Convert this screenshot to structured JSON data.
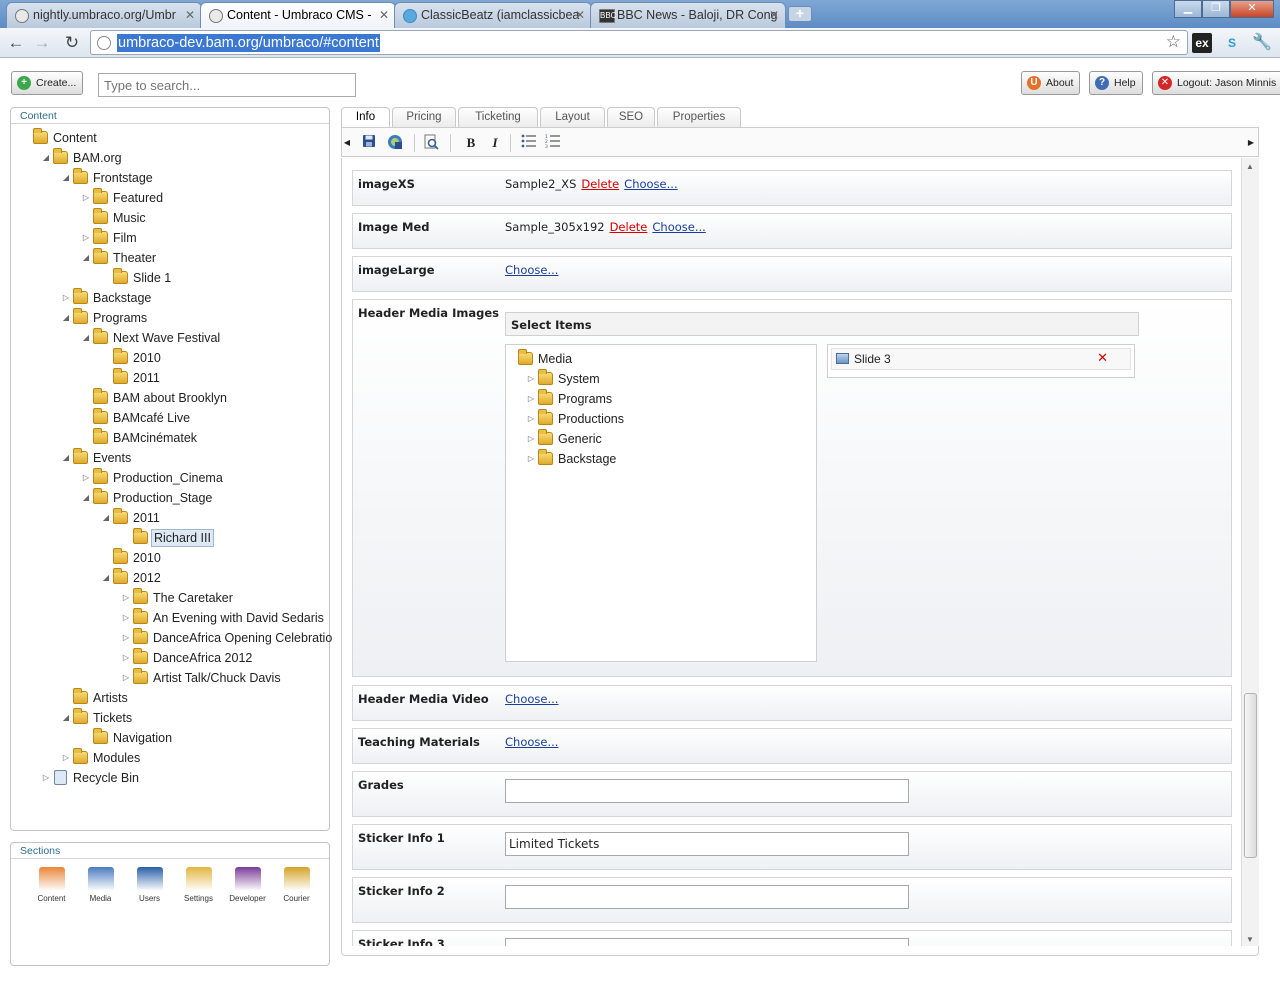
{
  "browser": {
    "tabs": [
      {
        "title": "nightly.umbraco.org/Umbr",
        "active": false,
        "favicon": "globe-icon"
      },
      {
        "title": "Content - Umbraco CMS - ",
        "active": true,
        "favicon": "globe-icon"
      },
      {
        "title": "ClassicBeatz (iamclassicbea",
        "active": false,
        "favicon": "twitter-icon"
      },
      {
        "title": "BBC News - Baloji, DR Cong",
        "active": false,
        "favicon": "bbc-icon"
      }
    ],
    "url": "umbraco-dev.bam.org/umbraco/#content",
    "ext_label": "ex"
  },
  "topbar": {
    "create_label": "Create...",
    "search_placeholder": "Type to search...",
    "about_label": "About",
    "help_label": "Help",
    "logout_label": "Logout: Jason Minnis"
  },
  "content_panel": {
    "header": "Content",
    "tree": [
      {
        "label": "Content",
        "depth": 0,
        "arrow": ""
      },
      {
        "label": "BAM.org",
        "depth": 1,
        "arrow": "open"
      },
      {
        "label": "Frontstage",
        "depth": 2,
        "arrow": "open"
      },
      {
        "label": "Featured",
        "depth": 3,
        "arrow": "closed"
      },
      {
        "label": "Music",
        "depth": 3,
        "arrow": ""
      },
      {
        "label": "Film",
        "depth": 3,
        "arrow": "closed"
      },
      {
        "label": "Theater",
        "depth": 3,
        "arrow": "open"
      },
      {
        "label": "Slide 1",
        "depth": 4,
        "arrow": ""
      },
      {
        "label": "Backstage",
        "depth": 2,
        "arrow": "closed"
      },
      {
        "label": "Programs",
        "depth": 2,
        "arrow": "open"
      },
      {
        "label": "Next Wave Festival",
        "depth": 3,
        "arrow": "open"
      },
      {
        "label": "2010",
        "depth": 4,
        "arrow": ""
      },
      {
        "label": "2011",
        "depth": 4,
        "arrow": ""
      },
      {
        "label": "BAM about Brooklyn",
        "depth": 3,
        "arrow": ""
      },
      {
        "label": "BAMcafé Live",
        "depth": 3,
        "arrow": ""
      },
      {
        "label": "BAMcinématek",
        "depth": 3,
        "arrow": ""
      },
      {
        "label": "Events",
        "depth": 2,
        "arrow": "open"
      },
      {
        "label": "Production_Cinema",
        "depth": 3,
        "arrow": "closed"
      },
      {
        "label": "Production_Stage",
        "depth": 3,
        "arrow": "open"
      },
      {
        "label": "2011",
        "depth": 4,
        "arrow": "open"
      },
      {
        "label": "Richard III",
        "depth": 5,
        "arrow": "",
        "selected": true
      },
      {
        "label": "2010",
        "depth": 4,
        "arrow": ""
      },
      {
        "label": "2012",
        "depth": 4,
        "arrow": "open"
      },
      {
        "label": "The Caretaker",
        "depth": 5,
        "arrow": "closed"
      },
      {
        "label": "An Evening with David Sedaris",
        "depth": 5,
        "arrow": "closed"
      },
      {
        "label": "DanceAfrica Opening Celebratio",
        "depth": 5,
        "arrow": "closed"
      },
      {
        "label": "DanceAfrica 2012",
        "depth": 5,
        "arrow": "closed"
      },
      {
        "label": "Artist Talk/Chuck Davis",
        "depth": 5,
        "arrow": "closed"
      },
      {
        "label": "Artists",
        "depth": 2,
        "arrow": ""
      },
      {
        "label": "Tickets",
        "depth": 2,
        "arrow": "open"
      },
      {
        "label": "Navigation",
        "depth": 3,
        "arrow": ""
      },
      {
        "label": "Modules",
        "depth": 2,
        "arrow": "closed"
      },
      {
        "label": "Recycle Bin",
        "depth": 1,
        "arrow": "closed",
        "icon": "recycle-bin-icon"
      }
    ]
  },
  "sections_panel": {
    "header": "Sections",
    "items": [
      {
        "label": "Content",
        "icon": "content-icon",
        "color": "#e9863a"
      },
      {
        "label": "Media",
        "icon": "media-icon",
        "color": "#4a7bc0"
      },
      {
        "label": "Users",
        "icon": "users-icon",
        "color": "#2b5fa8"
      },
      {
        "label": "Settings",
        "icon": "settings-icon",
        "color": "#e2b540"
      },
      {
        "label": "Developer",
        "icon": "developer-icon",
        "color": "#7a3d9a"
      },
      {
        "label": "Courier",
        "icon": "courier-icon",
        "color": "#d4a42a"
      }
    ]
  },
  "editor": {
    "tabs": [
      "Info",
      "Pricing",
      "Ticketing",
      "Layout",
      "SEO",
      "Properties"
    ],
    "active_tab": "Info",
    "toolbar": {
      "save_icon": "save-icon",
      "publish_icon": "save-and-publish-icon",
      "preview_icon": "preview-icon",
      "bold_label": "B",
      "italic_label": "I",
      "bullet_icon": "bullet-list-icon",
      "numbered_icon": "numbered-list-icon"
    },
    "fields": {
      "imageXS": {
        "label": "imageXS",
        "value": "Sample2_XS",
        "delete": "Delete",
        "choose": "Choose..."
      },
      "imageMed": {
        "label": "Image Med",
        "value": "Sample_305x192",
        "delete": "Delete",
        "choose": "Choose..."
      },
      "imageLarge": {
        "label": "imageLarge",
        "choose": "Choose..."
      },
      "headerMedia": {
        "label": "Header Media Images",
        "select_header": "Select Items",
        "media_root": "Media",
        "media_folders": [
          "System",
          "Programs",
          "Productions",
          "Generic",
          "Backstage"
        ],
        "selected": [
          "Slide 3"
        ]
      },
      "headerVideo": {
        "label": "Header Media Video",
        "choose": "Choose..."
      },
      "teaching": {
        "label": "Teaching Materials",
        "choose": "Choose..."
      },
      "grades": {
        "label": "Grades",
        "value": ""
      },
      "sticker1": {
        "label": "Sticker Info 1",
        "value": "Limited Tickets"
      },
      "sticker2": {
        "label": "Sticker Info 2",
        "value": ""
      },
      "sticker3": {
        "label": "Sticker Info 3",
        "value": ""
      }
    }
  }
}
